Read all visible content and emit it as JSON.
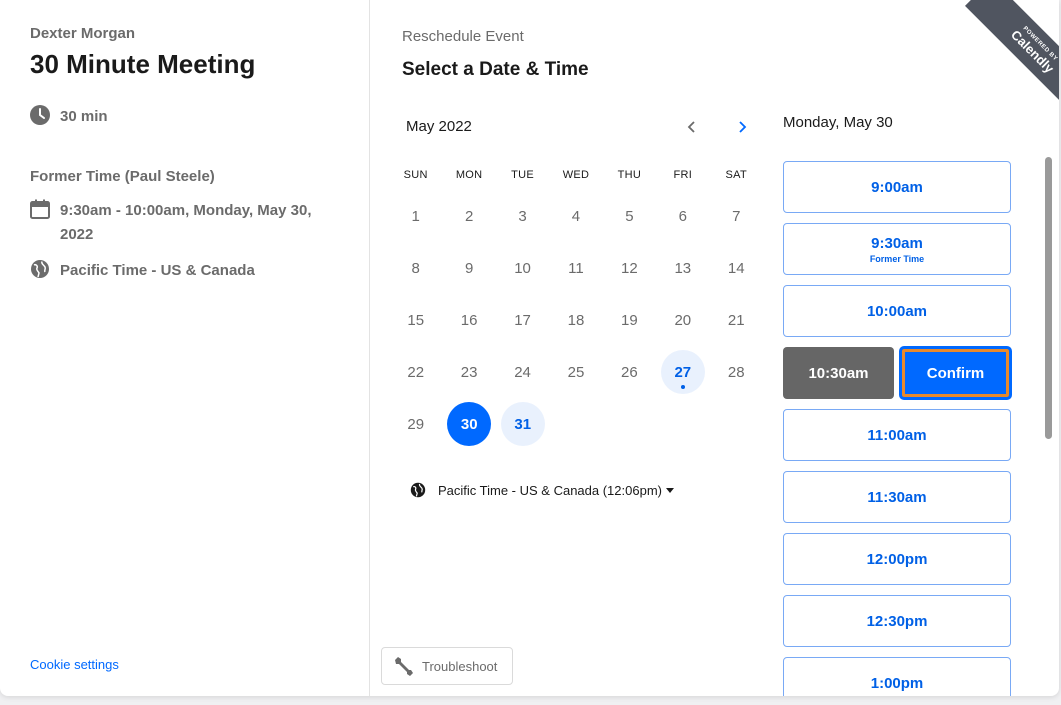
{
  "left": {
    "organizer": "Dexter Morgan",
    "title": "30 Minute Meeting",
    "duration": "30 min",
    "former_label": "Former Time (Paul Steele)",
    "former_time_line1": "9:30am - 10:00am, Monday, May 30,",
    "former_time_line2": "2022",
    "timezone": "Pacific Time - US & Canada",
    "cookie_settings": "Cookie settings"
  },
  "middle": {
    "reschedule_label": "Reschedule Event",
    "title": "Select a Date & Time",
    "month": "May 2022",
    "weekdays": [
      "SUN",
      "MON",
      "TUE",
      "WED",
      "THU",
      "FRI",
      "SAT"
    ],
    "weeks": [
      [
        {
          "d": "1",
          "s": "none"
        },
        {
          "d": "2",
          "s": "none"
        },
        {
          "d": "3",
          "s": "none"
        },
        {
          "d": "4",
          "s": "none"
        },
        {
          "d": "5",
          "s": "none"
        },
        {
          "d": "6",
          "s": "none"
        },
        {
          "d": "7",
          "s": "none"
        }
      ],
      [
        {
          "d": "8",
          "s": "none"
        },
        {
          "d": "9",
          "s": "none"
        },
        {
          "d": "10",
          "s": "none"
        },
        {
          "d": "11",
          "s": "none"
        },
        {
          "d": "12",
          "s": "none"
        },
        {
          "d": "13",
          "s": "none"
        },
        {
          "d": "14",
          "s": "none"
        }
      ],
      [
        {
          "d": "15",
          "s": "none"
        },
        {
          "d": "16",
          "s": "none"
        },
        {
          "d": "17",
          "s": "none"
        },
        {
          "d": "18",
          "s": "none"
        },
        {
          "d": "19",
          "s": "none"
        },
        {
          "d": "20",
          "s": "none"
        },
        {
          "d": "21",
          "s": "none"
        }
      ],
      [
        {
          "d": "22",
          "s": "none"
        },
        {
          "d": "23",
          "s": "none"
        },
        {
          "d": "24",
          "s": "none"
        },
        {
          "d": "25",
          "s": "none"
        },
        {
          "d": "26",
          "s": "none"
        },
        {
          "d": "27",
          "s": "today"
        },
        {
          "d": "28",
          "s": "none"
        }
      ],
      [
        {
          "d": "29",
          "s": "none"
        },
        {
          "d": "30",
          "s": "selected"
        },
        {
          "d": "31",
          "s": "available"
        }
      ]
    ],
    "timezone_select": "Pacific Time - US & Canada (12:06pm)",
    "troubleshoot": "Troubleshoot"
  },
  "right": {
    "date_label": "Monday, May 30",
    "slots": [
      {
        "time": "9:00am",
        "sub": ""
      },
      {
        "time": "9:30am",
        "sub": "Former Time"
      },
      {
        "time": "10:00am",
        "sub": ""
      }
    ],
    "selected_slot": "10:30am",
    "confirm_label": "Confirm",
    "slots_after": [
      "11:00am",
      "11:30am",
      "12:00pm",
      "12:30pm",
      "1:00pm"
    ]
  },
  "ribbon": {
    "powered_by": "POWERED BY",
    "brand": "Calendly"
  },
  "colors": {
    "accent": "#0069ff",
    "focus_ring": "#e8892b",
    "selected_slot_bg": "#666666"
  }
}
